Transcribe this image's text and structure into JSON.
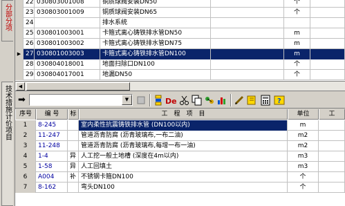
{
  "side_tabs": [
    "分部分项",
    "技术措施计价项目"
  ],
  "top_grid": {
    "rows": [
      {
        "num": "22",
        "code": "030803001008",
        "name": "铜质球阀安装DN50",
        "unit": "个",
        "selected": false
      },
      {
        "num": "23",
        "code": "030803001009",
        "name": "铜质球阀安装DN65",
        "unit": "个",
        "selected": false
      },
      {
        "num": "24",
        "code": "",
        "name": "排水系统",
        "unit": "",
        "selected": false
      },
      {
        "num": "25",
        "code": "030801003001",
        "name": "卡箍式离心铸铁排水管DN50",
        "unit": "m",
        "selected": false
      },
      {
        "num": "26",
        "code": "030801003002",
        "name": "卡箍式离心铸铁排水管DN75",
        "unit": "m",
        "selected": false
      },
      {
        "num": "27",
        "code": "030801003003",
        "name": "卡箍式离心铸铁排水管DN100",
        "unit": "m",
        "selected": true
      },
      {
        "num": "28",
        "code": "030804018001",
        "name": "地面扫除口DN100",
        "unit": "个",
        "selected": false
      },
      {
        "num": "29",
        "code": "030804017001",
        "name": "地漏DN50",
        "unit": "个",
        "selected": false
      }
    ]
  },
  "toolbar": {
    "search_value": "",
    "icons": [
      "arrow-right-icon",
      "filter-icon",
      "sort-icon",
      "de-icon",
      "cut-icon",
      "copy-icon",
      "link-icon",
      "chart-icon",
      "edit-icon",
      "book-icon",
      "calculator-icon",
      "help-icon"
    ]
  },
  "bottom_grid": {
    "headers": {
      "seq": "序号",
      "code": "编 号",
      "flag": "标",
      "name": "工　程　项　目",
      "unit": "单位",
      "rest": "工"
    },
    "rows": [
      {
        "seq": "1",
        "code": "8-245",
        "flag": "",
        "name": "室内柔性抗震铸铁排水管 (DN100以内)",
        "unit": "m",
        "selected": true
      },
      {
        "seq": "2",
        "code": "11-247",
        "flag": "",
        "name": "管道沥青防腐 (沥青玻璃布,一布二油)",
        "unit": "m2",
        "selected": false
      },
      {
        "seq": "3",
        "code": "11-248",
        "flag": "",
        "name": "管道沥青防腐 (沥青玻璃布,每增一布一油)",
        "unit": "m2",
        "selected": false
      },
      {
        "seq": "4",
        "code": "1-4",
        "flag": "异",
        "name": "人工挖一般土地槽 (深度在4m以内)",
        "unit": "m3",
        "selected": false
      },
      {
        "seq": "5",
        "code": "1-58",
        "flag": "异",
        "name": "人工回填土",
        "unit": "m3",
        "selected": false
      },
      {
        "seq": "6",
        "code": "A004",
        "flag": "补",
        "name": "不锈钢卡箍DN100",
        "unit": "个",
        "selected": false
      },
      {
        "seq": "7",
        "code": "8-162",
        "flag": "",
        "name": "弯头DN100",
        "unit": "个",
        "selected": false
      }
    ]
  }
}
